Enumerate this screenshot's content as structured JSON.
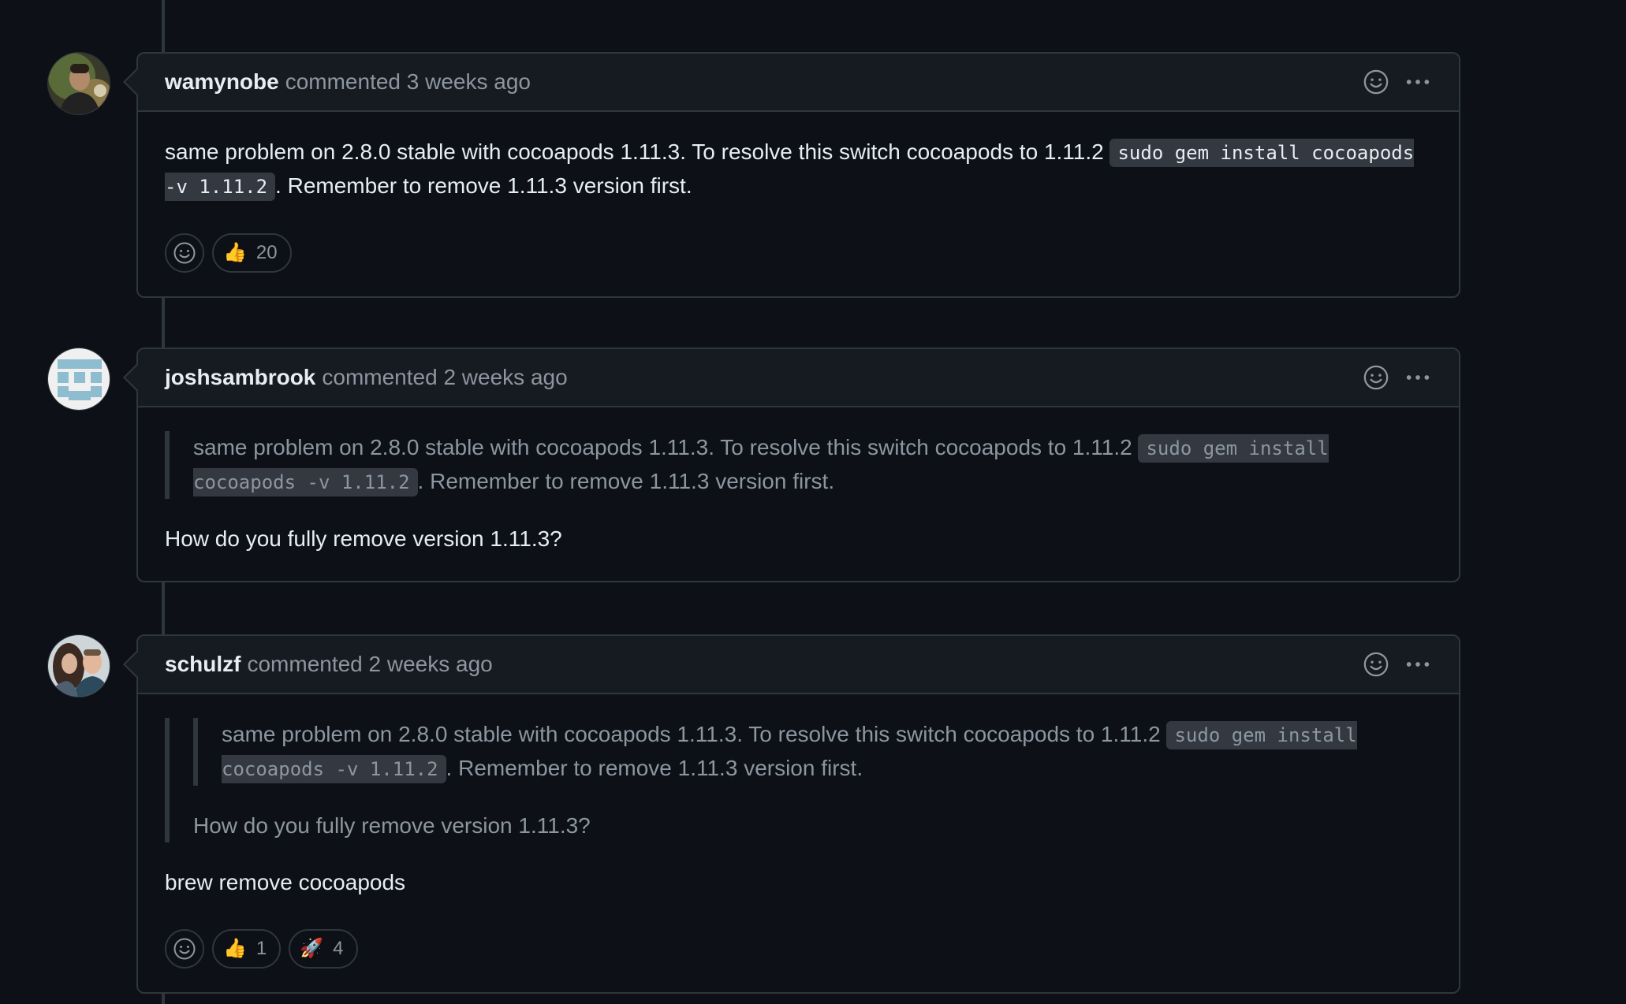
{
  "comments": [
    {
      "author": "wamynobe",
      "meta": "commented 3 weeks ago",
      "text_before": "same problem on 2.8.0 stable with cocoapods 1.11.3. To resolve this switch cocoapods to 1.11.2 ",
      "code": "sudo gem install cocoapods -v 1.11.2",
      "text_after": ". Remember to remove 1.11.3 version first.",
      "reactions": [
        {
          "emoji": "👍",
          "count": "20"
        }
      ]
    },
    {
      "author": "joshsambrook",
      "meta": "commented 2 weeks ago",
      "quote": {
        "text_before": "same problem on 2.8.0 stable with cocoapods 1.11.3. To resolve this switch cocoapods to 1.11.2 ",
        "code": "sudo gem install cocoapods -v 1.11.2",
        "text_after": ". Remember to remove 1.11.3 version first."
      },
      "text": "How do you fully remove version 1.11.3?"
    },
    {
      "author": "schulzf",
      "meta": "commented 2 weeks ago",
      "quote": {
        "inner": {
          "text_before": "same problem on 2.8.0 stable with cocoapods 1.11.3. To resolve this switch cocoapods to 1.11.2 ",
          "code": "sudo gem install cocoapods -v 1.11.2",
          "text_after": ". Remember to remove 1.11.3 version first."
        },
        "text": "How do you fully remove version 1.11.3?"
      },
      "text": "brew remove cocoapods",
      "reactions": [
        {
          "emoji": "👍",
          "count": "1"
        },
        {
          "emoji": "🚀",
          "count": "4"
        }
      ]
    }
  ],
  "icons": {
    "smiley": "smiley-icon",
    "more": "kebab-horizontal-icon"
  },
  "colors": {
    "background": "#0d1117",
    "header": "#161b22",
    "border": "#30363d",
    "muted_text": "#8d96a0",
    "text": "#e6edf3"
  }
}
